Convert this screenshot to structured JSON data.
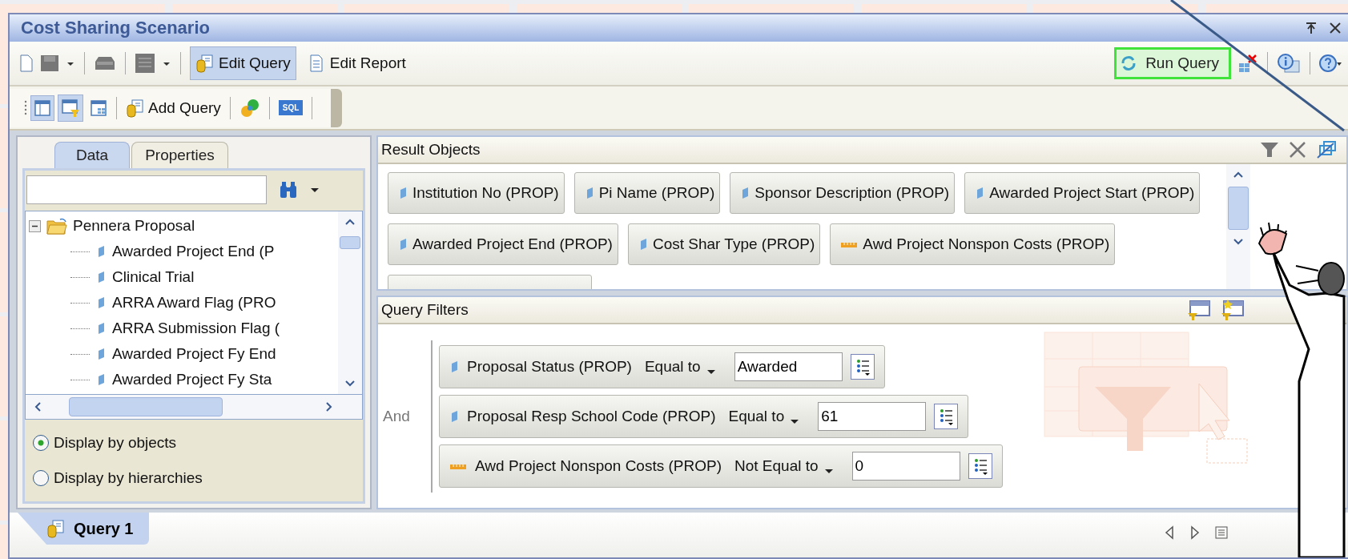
{
  "window": {
    "title": "Cost Sharing Scenario"
  },
  "toolbar": [
    {
      "kind": "new"
    },
    {
      "kind": "save"
    },
    {
      "kind": "caret"
    },
    {
      "kind": "sep"
    },
    {
      "kind": "print"
    },
    {
      "kind": "sep"
    },
    {
      "kind": "view"
    },
    {
      "kind": "caret"
    },
    {
      "kind": "sep"
    },
    {
      "kind": "edit-query",
      "label": "Edit Query",
      "selected": true
    },
    {
      "kind": "edit-report",
      "label": "Edit Report",
      "selected": false
    }
  ],
  "run_button": {
    "label": "Run Query",
    "highlighted": true
  },
  "query_toolbar": [
    {
      "kind": "layout",
      "pressed": true
    },
    {
      "kind": "filter-layout",
      "pressed": true
    },
    {
      "kind": "grid",
      "pressed": false
    },
    {
      "kind": "sep"
    },
    {
      "kind": "add",
      "label": "Add Query"
    },
    {
      "kind": "sep"
    },
    {
      "kind": "combine"
    },
    {
      "kind": "sep"
    },
    {
      "kind": "sql",
      "label": "SQL"
    },
    {
      "kind": "sep"
    }
  ],
  "side_tabs": [
    {
      "label": "Data",
      "selected": true
    },
    {
      "label": "Properties",
      "selected": false
    }
  ],
  "tree": {
    "label": "Pennera Proposal",
    "expanded": true,
    "children": [
      {
        "label": "Awarded Project End (P"
      },
      {
        "label": "Clinical Trial"
      },
      {
        "label": "ARRA Award Flag (PRO"
      },
      {
        "label": "ARRA Submission Flag ("
      },
      {
        "label": "Awarded Project Fy End"
      },
      {
        "label": "Awarded Project Fy Sta"
      }
    ]
  },
  "display_options": [
    {
      "label": "Display by objects",
      "selected": true
    },
    {
      "label": "Display by hierarchies",
      "selected": false
    }
  ],
  "result_objects": {
    "title": "Result Objects",
    "items": [
      {
        "kind": "dimension",
        "label": "Institution No (PROP)"
      },
      {
        "kind": "dimension",
        "label": "Pi Name (PROP)"
      },
      {
        "kind": "dimension",
        "label": "Sponsor Description (PROP)"
      },
      {
        "kind": "dimension",
        "label": "Awarded Project Start (PROP)"
      },
      {
        "kind": "dimension",
        "label": "Awarded Project End (PROP)"
      },
      {
        "kind": "dimension",
        "label": "Cost Shar Type (PROP)"
      },
      {
        "kind": "measure",
        "label": "Awd Project Nonspon Costs (PROP)"
      }
    ]
  },
  "query_filters": {
    "title": "Query Filters",
    "operator": "And",
    "items": [
      {
        "kind": "dimension",
        "object": "Proposal Status (PROP)",
        "condition": "Equal to",
        "value": "Awarded"
      },
      {
        "kind": "dimension",
        "object": "Proposal Resp School Code (PROP)",
        "condition": "Equal to",
        "value": "61"
      },
      {
        "kind": "measure",
        "object": "Awd Project Nonspon Costs (PROP)",
        "condition": "Not Equal to",
        "value": "0"
      }
    ]
  },
  "bottom_tabs": [
    {
      "label": "Query 1",
      "selected": true
    }
  ]
}
